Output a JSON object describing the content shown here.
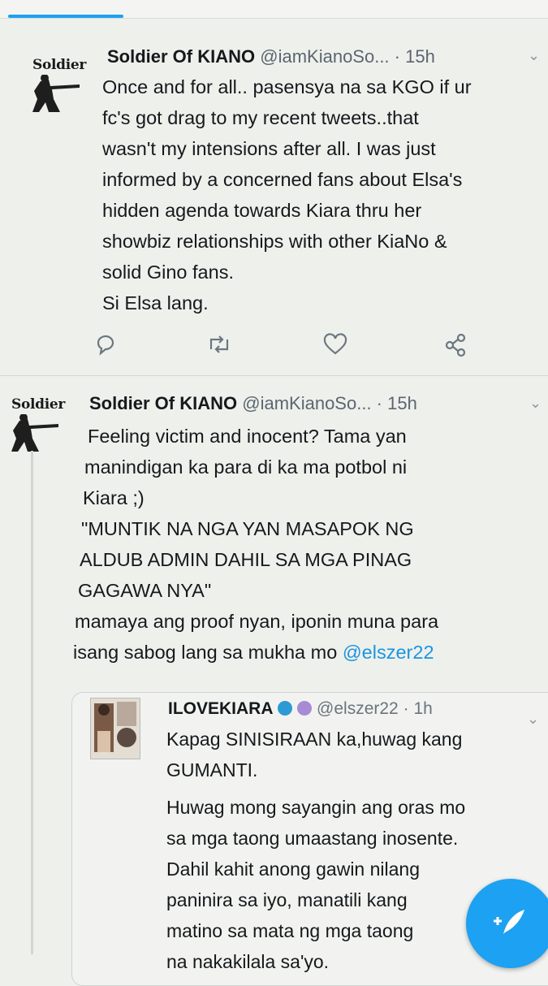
{
  "tweets": [
    {
      "author_name": "Soldier Of KIANO",
      "author_handle": "@iamKianoSo...",
      "separator": "·",
      "time": "15h",
      "avatar_text": "Soldier",
      "lines": [
        "Once and for all.. pasensya na sa KGO if ur",
        "fc's got drag to my recent tweets..that",
        "wasn't my intensions after all. I was just",
        "informed by a concerned fans about Elsa's",
        "hidden agenda towards Kiara thru her",
        "showbiz relationships with other KiaNo &",
        "solid Gino fans.",
        "Si Elsa lang."
      ],
      "actions": [
        "reply-icon",
        "retweet-icon",
        "like-icon",
        "share-icon"
      ]
    },
    {
      "author_name": "Soldier Of KIANO",
      "author_handle": "@iamKianoSo...",
      "separator": "·",
      "time": "15h",
      "avatar_text": "Soldier",
      "lines": [
        "Feeling victim and inocent? Tama yan",
        "manindigan ka para di ka ma potbol ni",
        "Kiara ;)",
        "\"MUNTIK NA NGA YAN MASAPOK NG",
        "ALDUB ADMIN DAHIL SA MGA PINAG",
        "GAGAWA NYA\"",
        "mamaya ang proof nyan, iponin muna para",
        "isang sabog lang sa mukha mo"
      ],
      "mention": "@elszer22"
    }
  ],
  "quote": {
    "author_name": "ILOVEKIARA",
    "author_handle": "@elszer22",
    "separator": "·",
    "time": "1h",
    "lines": [
      "Kapag SINISIRAAN ka,huwag kang",
      "GUMANTI.",
      "Huwag mong sayangin ang oras mo",
      "sa mga taong umaastang inosente.",
      "Dahil kahit anong gawin nilang",
      "paninira sa iyo, manatili kang",
      "matino  sa mata ng mga taong",
      "na nakakilala sa'yo."
    ]
  },
  "colors": {
    "accent": "#1da1f2",
    "mention": "#1b95e0",
    "background": "#eef0ec"
  },
  "fab_icon": "compose-feather-icon"
}
